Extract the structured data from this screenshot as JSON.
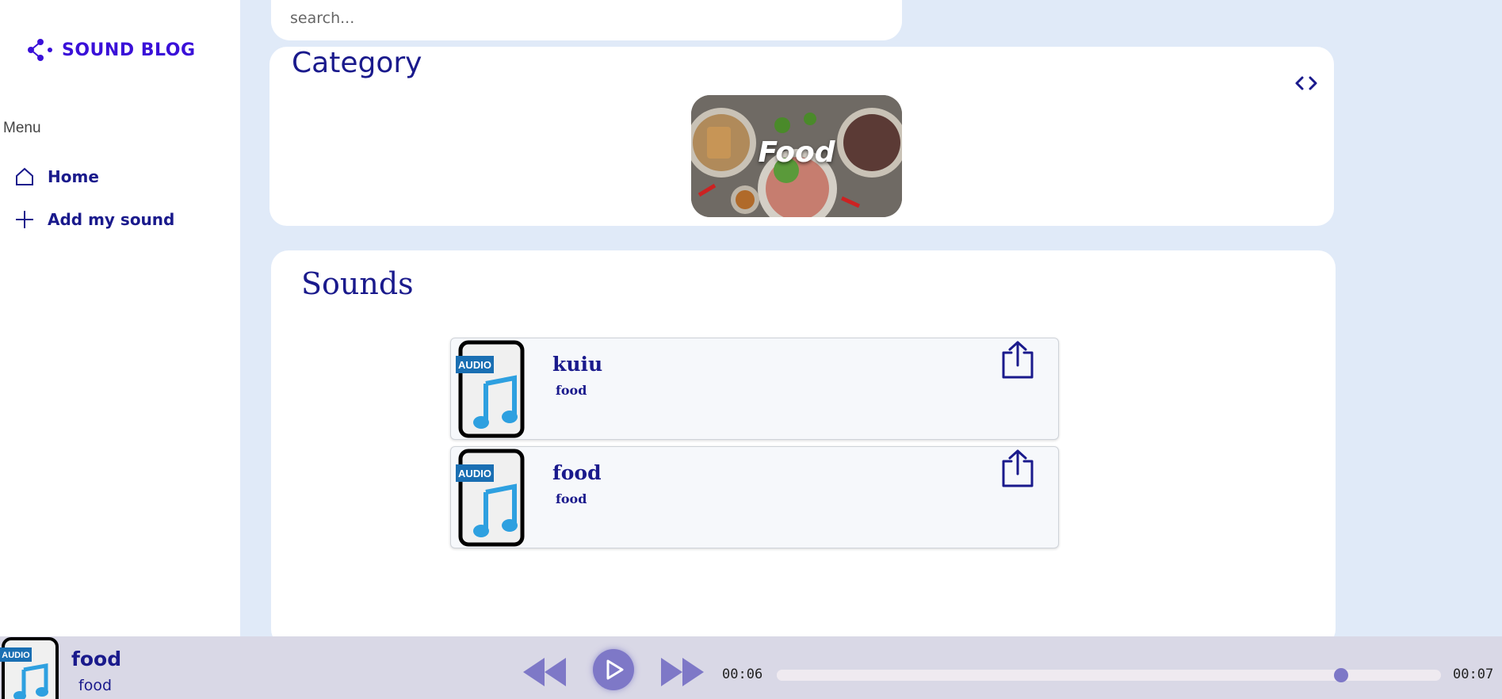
{
  "app": {
    "name": "SOUND BLOG",
    "accent": "#3a10d8",
    "text_color": "#1a1a8c",
    "background": "#e0eaf8"
  },
  "sidebar": {
    "menu_label": "Menu",
    "items": [
      {
        "label": "Home",
        "icon": "home-icon"
      },
      {
        "label": "Add my sound",
        "icon": "plus-icon"
      }
    ]
  },
  "search": {
    "placeholder": "search..."
  },
  "category": {
    "title": "Category",
    "nav_icon": "code-brackets-icon",
    "tiles": [
      {
        "label": "Food"
      }
    ]
  },
  "sounds": {
    "title": "Sounds",
    "items": [
      {
        "name": "kuiu",
        "category": "food",
        "thumb_badge": "AUDIO"
      },
      {
        "name": "food",
        "category": "food",
        "thumb_badge": "AUDIO"
      }
    ]
  },
  "player": {
    "track_name": "food",
    "track_category": "food",
    "thumb_badge": "AUDIO",
    "current_time": "00:06",
    "duration": "00:07",
    "progress_fraction": 0.85,
    "controls": [
      "rewind-icon",
      "play-icon",
      "fast-forward-icon"
    ],
    "control_color": "#7e78c7"
  }
}
